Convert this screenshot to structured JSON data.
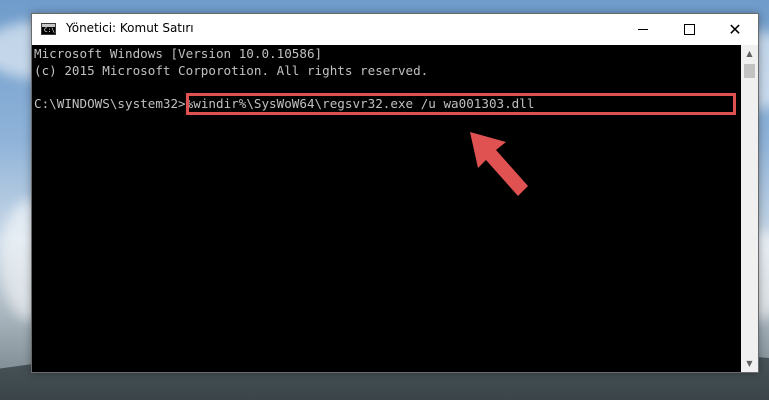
{
  "window": {
    "title": "Yönetici: Komut Satırı",
    "icon_label": "C:\\",
    "controls": {
      "minimize": "minimize-icon",
      "maximize": "maximize-icon",
      "close": "close-icon"
    }
  },
  "console": {
    "line1": "Microsoft Windows [Version 10.0.10586]",
    "line2": "(c) 2015 Microsoft Corporotion. All rights reserved.",
    "prompt": "C:\\WINDOWS\\system32>",
    "command": "%windir%\\SysWoW64\\regsvr32.exe /u wa001303.dll"
  },
  "colors": {
    "console_bg": "#000000",
    "console_text": "#c0c0c0",
    "highlight": "#e05252",
    "arrow": "#e05252"
  }
}
